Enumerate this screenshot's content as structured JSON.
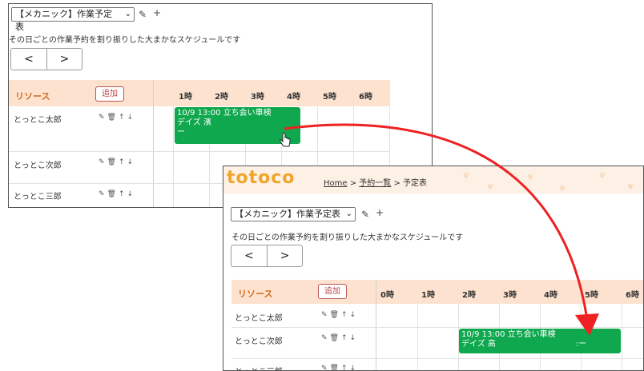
{
  "colors": {
    "event_green": "#0fa84e",
    "header_band": "#fde3cf",
    "arrow_red": "#ee2222",
    "logo_orange": "#f0a52a"
  },
  "schedule_select": "【メカニック】作業予定表",
  "description": "その日ごとの作業予約を割り振りした大まかなスケジュールです",
  "nav": {
    "prev": "<",
    "next": ">"
  },
  "resources_label": "リソース",
  "add_label": "追加",
  "icons": {
    "edit": "edit-icon",
    "add": "plus-icon",
    "trash": "trash-icon",
    "up": "arrow-up-icon",
    "down": "arrow-down-icon"
  },
  "window1": {
    "hours": [
      "1時",
      "2時",
      "3時",
      "4時",
      "5時",
      "6時"
    ],
    "resources": [
      "とっとこ太郎",
      "とっとこ次郎",
      "とっとこ三郎"
    ],
    "event": {
      "line1": "10/9 13:00 立ち会い車検",
      "line2": "デイズ 濱",
      "line3": "ー"
    }
  },
  "window2": {
    "logo": "totoco",
    "breadcrumb": {
      "home": "Home",
      "sep1": " > ",
      "list": "予約一覧",
      "sep2": " > ",
      "current": "予定表"
    },
    "hours": [
      "0時",
      "1時",
      "2時",
      "3時",
      "4時",
      "5時",
      "6時"
    ],
    "resources": [
      "とっとこ太郎",
      "とっとこ次郎",
      "とっとこ三郎"
    ],
    "event": {
      "line1": "10/9 13:00 立ち会い車検",
      "line2": "デイズ 高",
      "tail": ":ー"
    }
  }
}
